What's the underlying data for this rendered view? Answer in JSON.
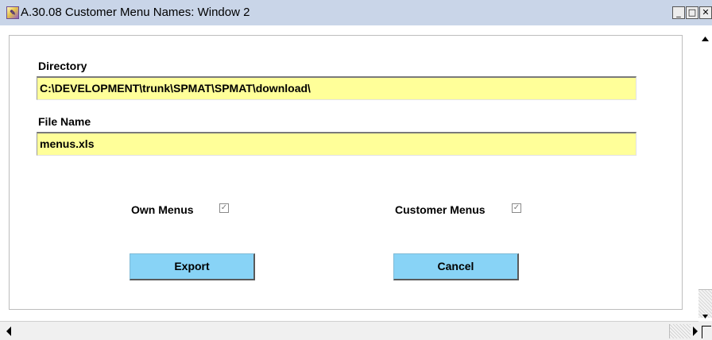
{
  "window": {
    "title": "A.30.08 Customer Menu Names: Window 2",
    "app_icon": "app-icon",
    "minimize_glyph": "_",
    "maximize_glyph": "□",
    "close_glyph": "✕"
  },
  "form": {
    "directory_label": "Directory",
    "directory_value": "C:\\DEVELOPMENT\\trunk\\SPMAT\\SPMAT\\download\\",
    "filename_label": "File Name",
    "filename_value": "menus.xls",
    "own_menus_label": "Own Menus",
    "own_menus_checked": true,
    "customer_menus_label": "Customer Menus",
    "customer_menus_checked": true,
    "check_glyph": "✓"
  },
  "buttons": {
    "export_label": "Export",
    "cancel_label": "Cancel"
  },
  "colors": {
    "titlebar": "#c9d5e8",
    "field_bg": "#ffff99",
    "button_bg": "#88d3f6"
  }
}
